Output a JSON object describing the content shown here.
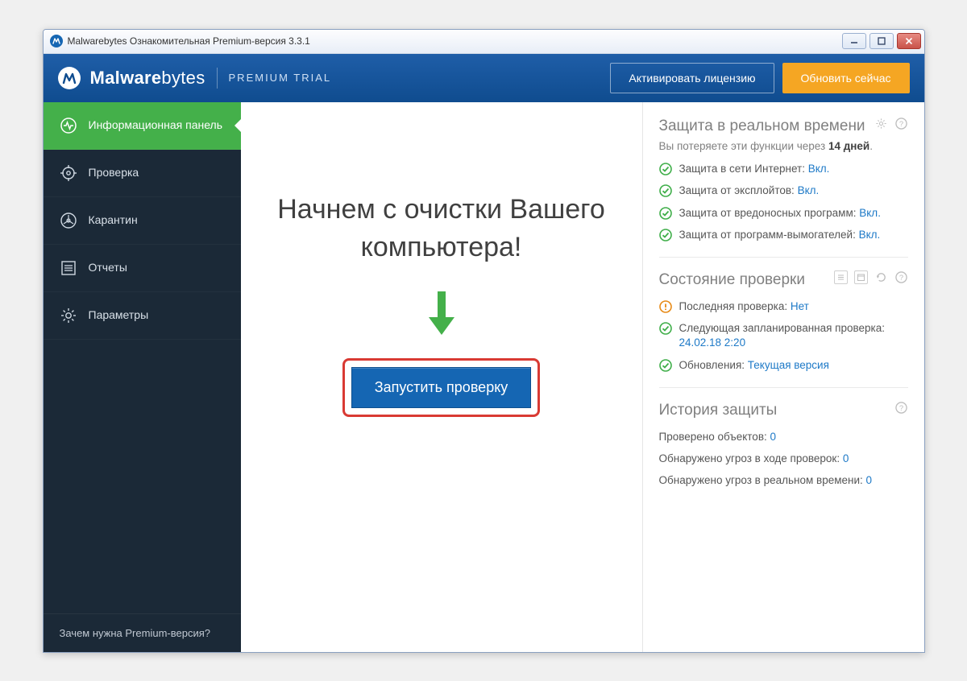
{
  "titlebar": {
    "title": "Malwarebytes Ознакомительная Premium-версия 3.3.1"
  },
  "header": {
    "logo_prefix": "Malware",
    "logo_suffix": "bytes",
    "edition": "PREMIUM TRIAL",
    "activate_label": "Активировать лицензию",
    "upgrade_label": "Обновить сейчас"
  },
  "sidebar": {
    "items": [
      {
        "label": "Информационная панель"
      },
      {
        "label": "Проверка"
      },
      {
        "label": "Карантин"
      },
      {
        "label": "Отчеты"
      },
      {
        "label": "Параметры"
      }
    ],
    "footer": "Зачем нужна Premium-версия?"
  },
  "main": {
    "headline": "Начнем с очистки Вашего компьютера!",
    "run_scan": "Запустить проверку"
  },
  "right": {
    "rt": {
      "title": "Защита в реальном времени",
      "sub_prefix": "Вы потеряете эти функции через ",
      "sub_days": "14 дней",
      "sub_suffix": ".",
      "items": [
        {
          "label": "Защита в сети Интернет:",
          "value": "Вкл."
        },
        {
          "label": "Защита от эксплойтов:",
          "value": "Вкл."
        },
        {
          "label": "Защита от вредоносных программ:",
          "value": "Вкл."
        },
        {
          "label": "Защита от программ-вымогателей:",
          "value": "Вкл."
        }
      ]
    },
    "scan": {
      "title": "Состояние проверки",
      "items": [
        {
          "status": "warn",
          "label": "Последняя проверка:",
          "value": "Нет"
        },
        {
          "status": "ok",
          "label": "Следующая запланированная проверка:",
          "value": "24.02.18 2:20",
          "wrap": true
        },
        {
          "status": "ok",
          "label": "Обновления:",
          "value": "Текущая версия"
        }
      ]
    },
    "history": {
      "title": "История защиты",
      "items": [
        {
          "label": "Проверено объектов:",
          "value": "0"
        },
        {
          "label": "Обнаружено угроз в ходе проверок:",
          "value": "0"
        },
        {
          "label": "Обнаружено угроз в реальном времени:",
          "value": "0"
        }
      ]
    }
  }
}
